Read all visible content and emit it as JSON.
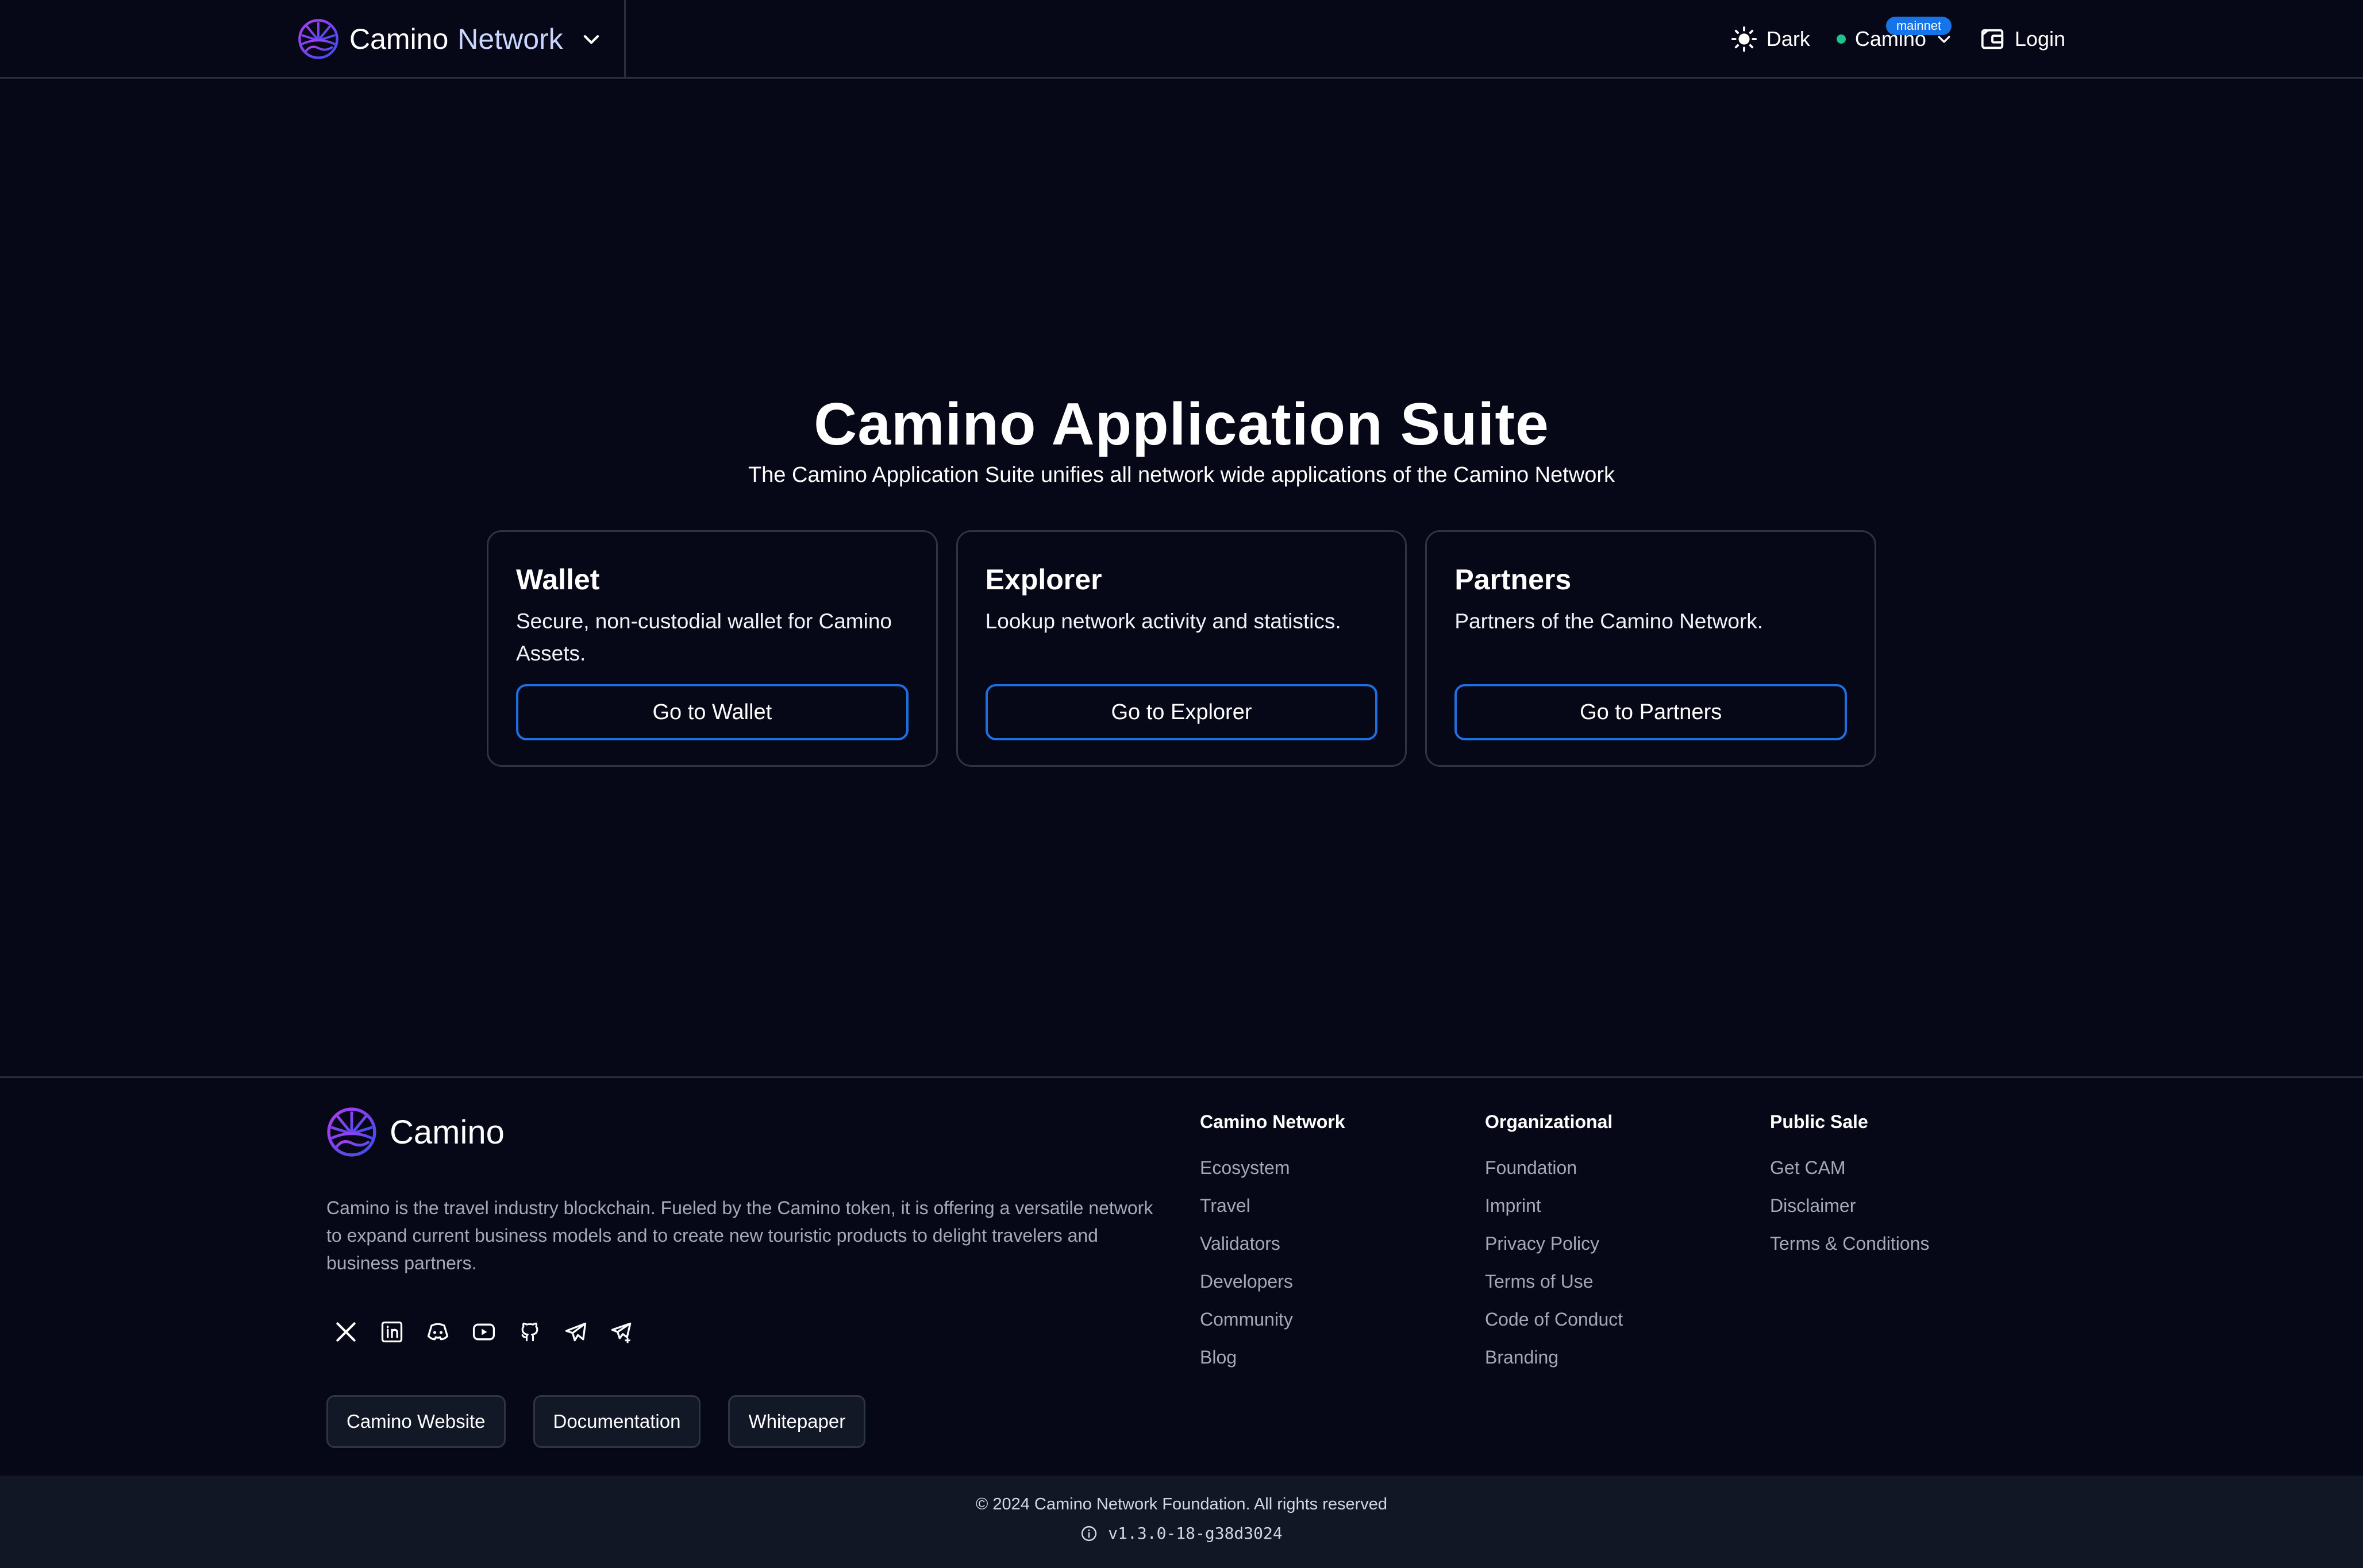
{
  "header": {
    "brand_name": "Camino",
    "brand_suffix": "Network",
    "theme_label": "Dark",
    "network_label": "Camino",
    "network_badge": "mainnet",
    "login_label": "Login",
    "icons": [
      "camino-logo-icon",
      "chevron-down-icon",
      "sun-icon",
      "network-dot-icon",
      "wallet-icon"
    ]
  },
  "hero": {
    "title": "Camino Application Suite",
    "subtitle": "The Camino Application Suite unifies all network wide applications of the Camino Network"
  },
  "cards": [
    {
      "title": "Wallet",
      "description": "Secure, non-custodial wallet for Camino Assets.",
      "button": "Go to Wallet"
    },
    {
      "title": "Explorer",
      "description": "Lookup network activity and statistics.",
      "button": "Go to Explorer"
    },
    {
      "title": "Partners",
      "description": "Partners of the Camino Network.",
      "button": "Go to Partners"
    }
  ],
  "footer": {
    "brand_name": "Camino",
    "description": "Camino is the travel industry blockchain. Fueled by the Camino token, it is offering a versatile network to expand current business models and to create new touristic products to delight travelers and business partners.",
    "socials": [
      "x-icon",
      "linkedin-icon",
      "discord-icon",
      "youtube-icon",
      "github-icon",
      "telegram-icon",
      "telegram-announcements-icon"
    ],
    "buttons": [
      "Camino Website",
      "Documentation",
      "Whitepaper"
    ],
    "columns": [
      {
        "title": "Camino Network",
        "links": [
          "Ecosystem",
          "Travel",
          "Validators",
          "Developers",
          "Community",
          "Blog"
        ]
      },
      {
        "title": "Organizational",
        "links": [
          "Foundation",
          "Imprint",
          "Privacy Policy",
          "Terms of Use",
          "Code of Conduct",
          "Branding"
        ]
      },
      {
        "title": "Public Sale",
        "links": [
          "Get CAM",
          "Disclaimer",
          "Terms & Conditions"
        ]
      }
    ],
    "copyright": "© 2024 Camino Network Foundation. All rights reserved",
    "version": "v1.3.0-18-g38d3024"
  },
  "colors": {
    "background": "#060817",
    "accent": "#1f6fe0",
    "badge": "#1773e8",
    "status_online": "#22c08a",
    "muted_text": "#a3a9b8"
  }
}
